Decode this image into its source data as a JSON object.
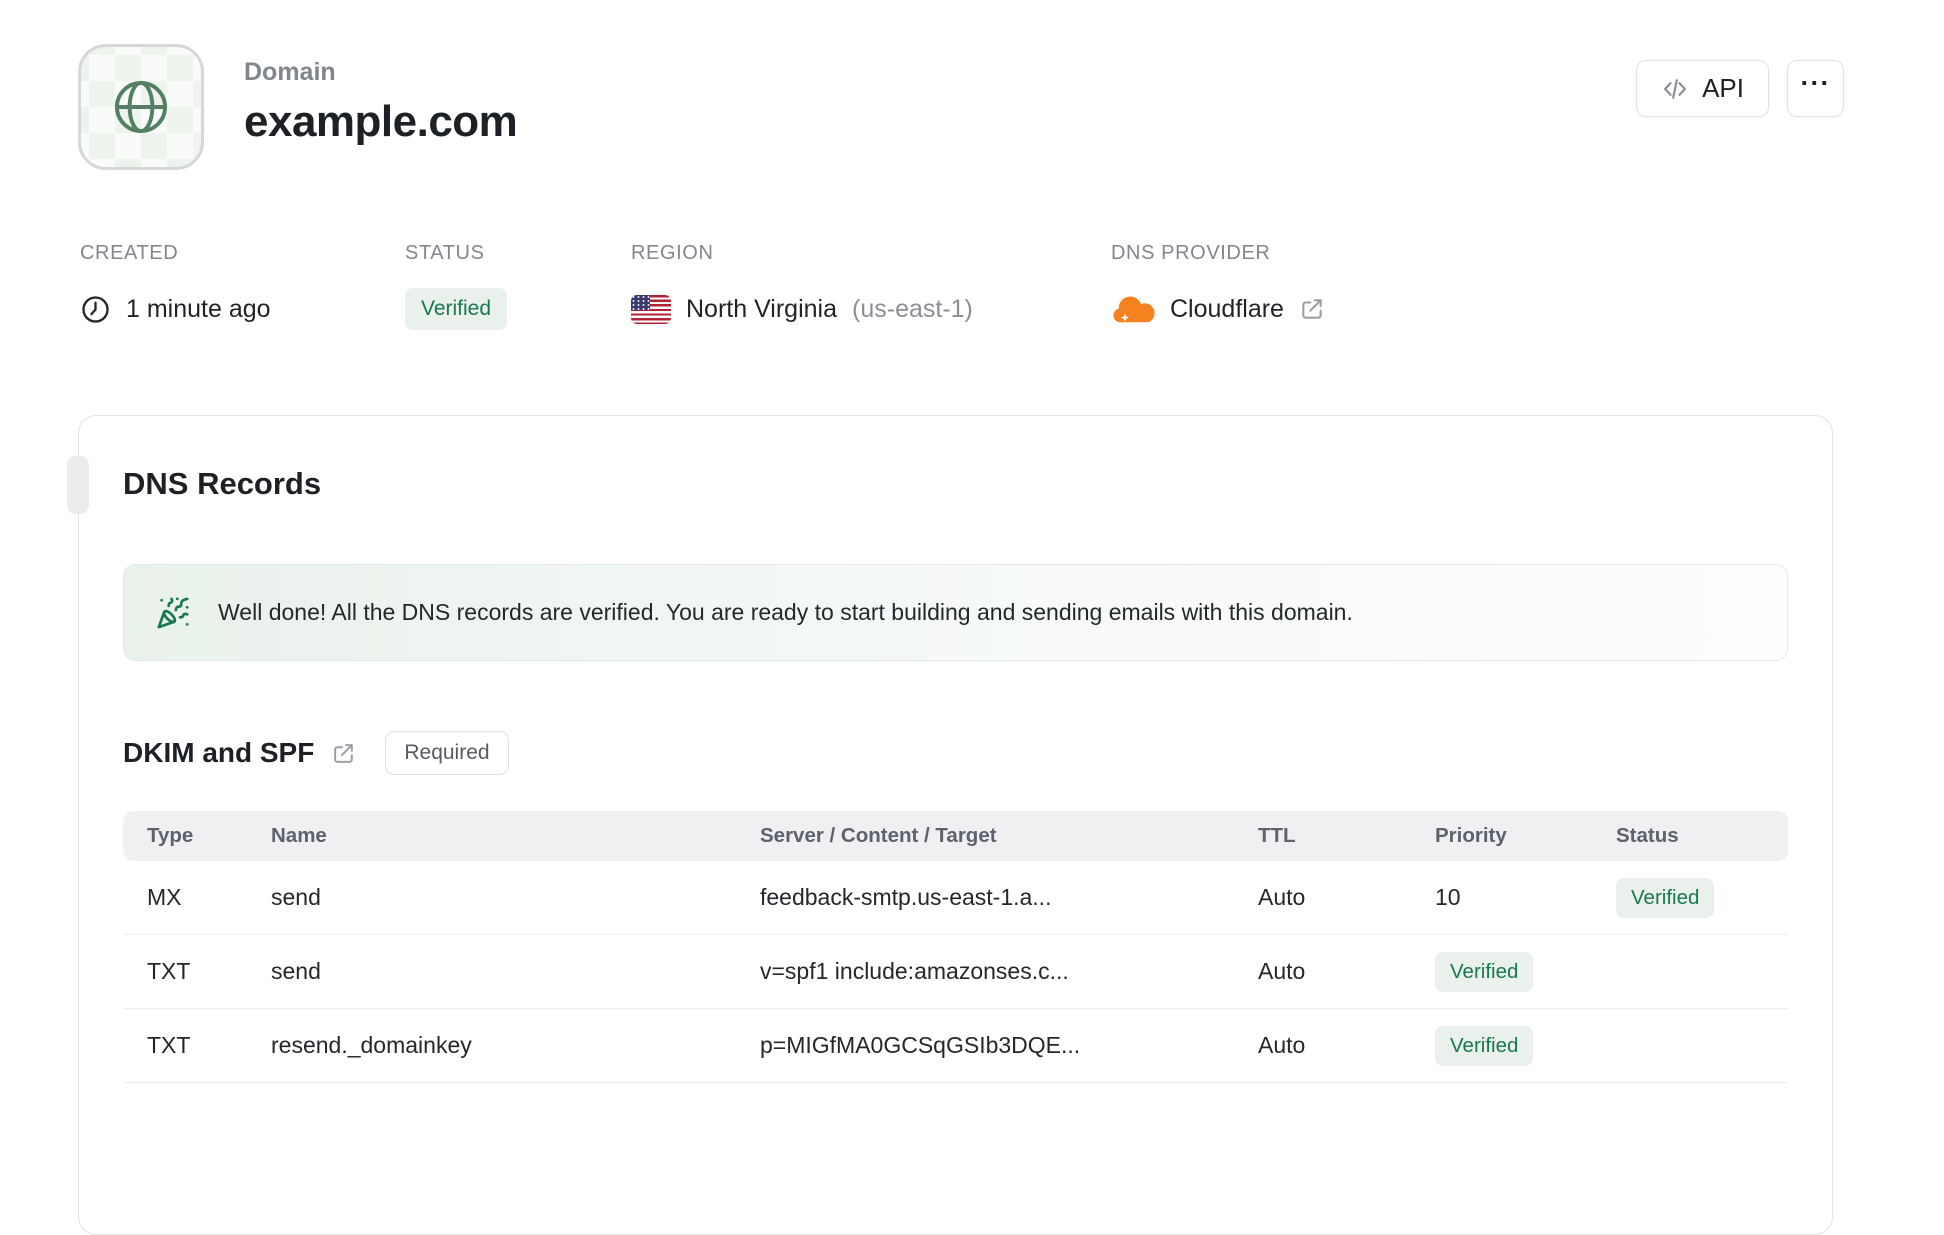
{
  "header": {
    "label": "Domain",
    "title": "example.com",
    "api_button": "API",
    "more_button": "···"
  },
  "meta": {
    "created": {
      "label": "CREATED",
      "value": "1 minute ago"
    },
    "status": {
      "label": "STATUS",
      "value": "Verified"
    },
    "region": {
      "label": "REGION",
      "name": "North Virginia",
      "code": "(us-east-1)"
    },
    "dns_provider": {
      "label": "DNS PROVIDER",
      "value": "Cloudflare"
    }
  },
  "dns_records": {
    "title": "DNS Records",
    "success_message": "Well done! All the DNS records are verified. You are ready to start building and sending emails with this domain.",
    "section": {
      "title": "DKIM and SPF",
      "badge": "Required"
    },
    "table": {
      "headers": [
        "Type",
        "Name",
        "Server / Content / Target",
        "TTL",
        "Priority",
        "Status"
      ],
      "rows": [
        {
          "type": "MX",
          "name": "send",
          "content": "feedback-smtp.us-east-1.a...",
          "ttl": "Auto",
          "priority": "10",
          "status": "Verified"
        },
        {
          "type": "TXT",
          "name": "send",
          "content": "v=spf1 include:amazonses.c...",
          "ttl": "Auto",
          "priority": "",
          "status": "Verified"
        },
        {
          "type": "TXT",
          "name": "resend._domainkey",
          "content": "p=MIGfMA0GCSqGSIb3DQE...",
          "ttl": "Auto",
          "priority": "",
          "status": "Verified"
        }
      ]
    }
  },
  "icons": {
    "app": "globe-icon",
    "api": "code-icon",
    "more": "ellipsis-icon",
    "created": "clock-icon",
    "region": "us-flag-icon",
    "dns_provider": "cloudflare-icon",
    "external": "external-link-icon",
    "success": "party-popper-icon"
  },
  "colors": {
    "accent_green": "#18794e",
    "green_badge_bg": "#eaf0eb",
    "globe_green": "#557f61",
    "cloudflare_orange": "#f6821f",
    "cloudflare_light_orange": "#fbad41",
    "border": "#e2e4e8",
    "table_header_bg": "#f0f0f3",
    "text_dark": "#1d2125",
    "text_gray": "#82868f"
  }
}
